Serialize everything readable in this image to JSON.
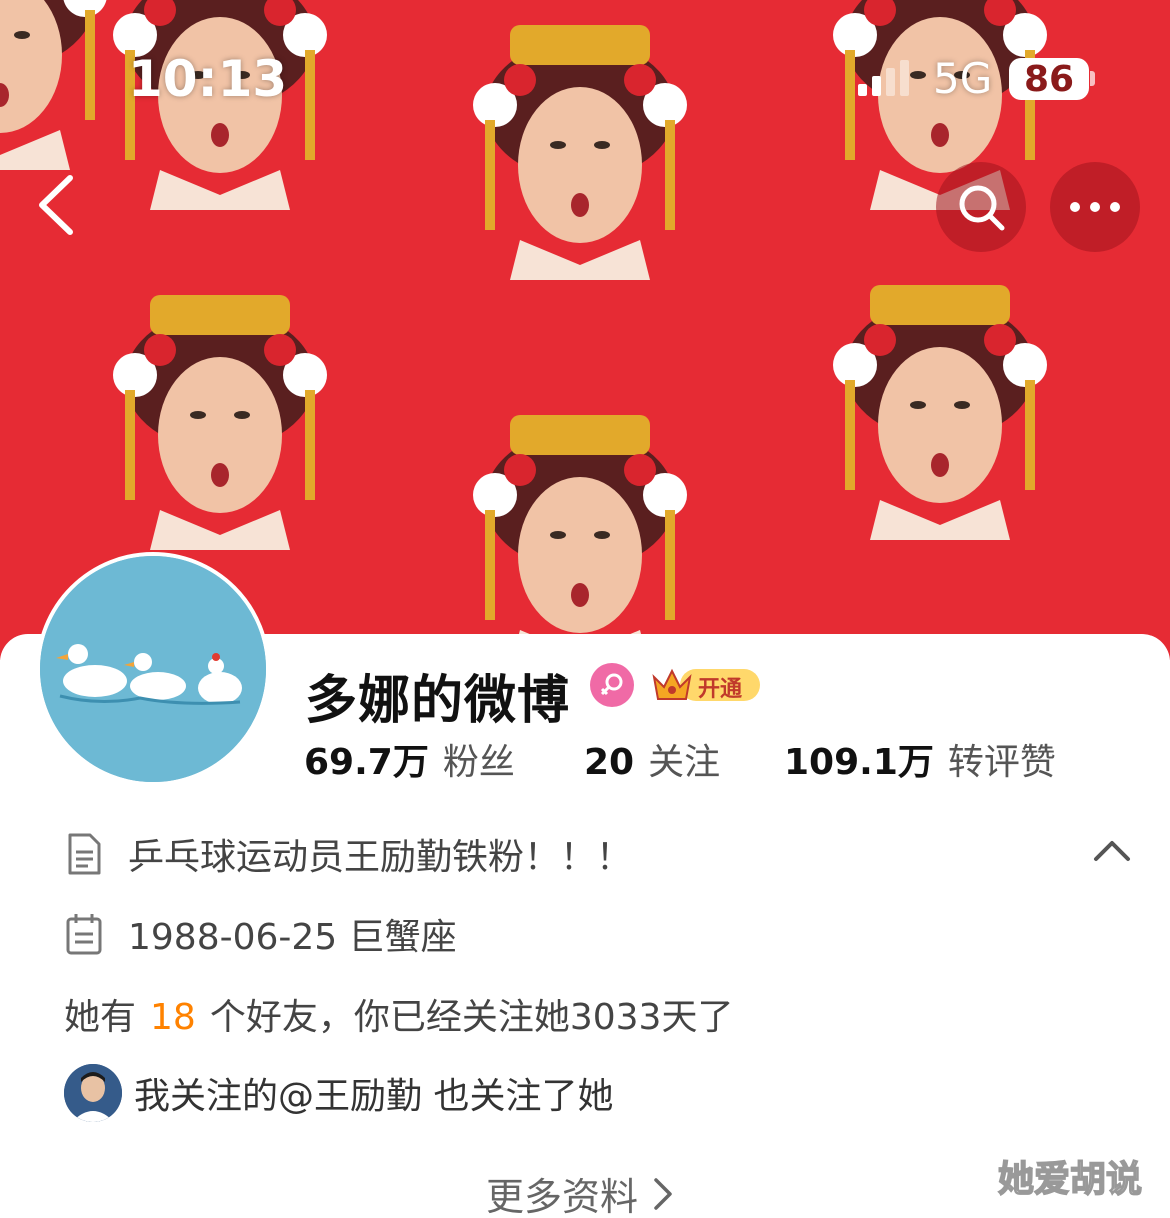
{
  "status_bar": {
    "time": "10:13",
    "network": "5G",
    "battery": "86"
  },
  "header": {
    "back_icon": "chevron-left-icon",
    "search_icon": "search-icon",
    "more_icon": "more-horizontal-icon"
  },
  "profile": {
    "name": "多娜的微博",
    "gender_icon": "female-icon",
    "vip_label": "开通",
    "stats": {
      "fans_value": "69.7万",
      "fans_label": "粉丝",
      "following_value": "20",
      "following_label": "关注",
      "likes_value": "109.1万",
      "likes_label": "转评赞"
    },
    "bio": "乒乓球运动员王励勤铁粉！！！",
    "birthday": "1988-06-25 巨蟹座",
    "friends_prefix": "她有",
    "friends_count": "18",
    "friends_suffix": "个好友，你已经关注她3033天了",
    "mutual_text": "我关注的@王励勤 也关注了她",
    "more_info": "更多资料"
  },
  "watermark": "她爱胡说",
  "colors": {
    "banner": "#e62b34",
    "accent_orange": "#ff8200",
    "avatar_bg": "#6db9d4",
    "female_badge": "#f06aa6"
  }
}
